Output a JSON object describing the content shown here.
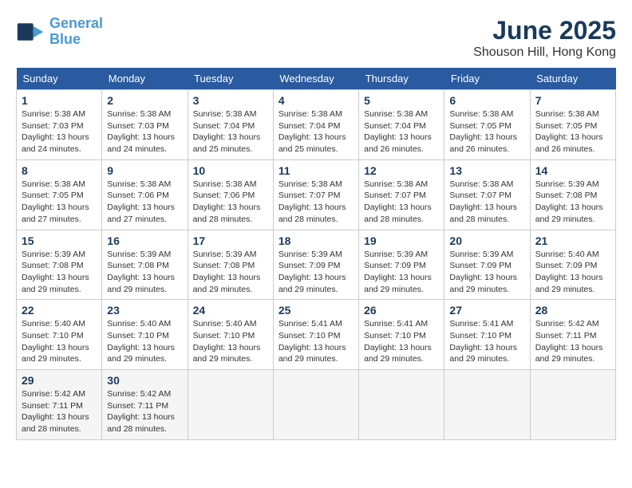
{
  "header": {
    "logo_line1": "General",
    "logo_line2": "Blue",
    "title": "June 2025",
    "subtitle": "Shouson Hill, Hong Kong"
  },
  "calendar": {
    "days_of_week": [
      "Sunday",
      "Monday",
      "Tuesday",
      "Wednesday",
      "Thursday",
      "Friday",
      "Saturday"
    ],
    "weeks": [
      [
        null,
        {
          "day": "2",
          "sunrise": "5:38 AM",
          "sunset": "7:03 PM",
          "daylight": "13 hours and 24 minutes."
        },
        {
          "day": "3",
          "sunrise": "5:38 AM",
          "sunset": "7:04 PM",
          "daylight": "13 hours and 25 minutes."
        },
        {
          "day": "4",
          "sunrise": "5:38 AM",
          "sunset": "7:04 PM",
          "daylight": "13 hours and 25 minutes."
        },
        {
          "day": "5",
          "sunrise": "5:38 AM",
          "sunset": "7:04 PM",
          "daylight": "13 hours and 26 minutes."
        },
        {
          "day": "6",
          "sunrise": "5:38 AM",
          "sunset": "7:05 PM",
          "daylight": "13 hours and 26 minutes."
        },
        {
          "day": "7",
          "sunrise": "5:38 AM",
          "sunset": "7:05 PM",
          "daylight": "13 hours and 26 minutes."
        }
      ],
      [
        {
          "day": "1",
          "sunrise": "5:38 AM",
          "sunset": "7:03 PM",
          "daylight": "13 hours and 24 minutes."
        },
        null,
        null,
        null,
        null,
        null,
        null
      ],
      [
        {
          "day": "8",
          "sunrise": "5:38 AM",
          "sunset": "7:05 PM",
          "daylight": "13 hours and 27 minutes."
        },
        {
          "day": "9",
          "sunrise": "5:38 AM",
          "sunset": "7:06 PM",
          "daylight": "13 hours and 27 minutes."
        },
        {
          "day": "10",
          "sunrise": "5:38 AM",
          "sunset": "7:06 PM",
          "daylight": "13 hours and 28 minutes."
        },
        {
          "day": "11",
          "sunrise": "5:38 AM",
          "sunset": "7:07 PM",
          "daylight": "13 hours and 28 minutes."
        },
        {
          "day": "12",
          "sunrise": "5:38 AM",
          "sunset": "7:07 PM",
          "daylight": "13 hours and 28 minutes."
        },
        {
          "day": "13",
          "sunrise": "5:38 AM",
          "sunset": "7:07 PM",
          "daylight": "13 hours and 28 minutes."
        },
        {
          "day": "14",
          "sunrise": "5:39 AM",
          "sunset": "7:08 PM",
          "daylight": "13 hours and 29 minutes."
        }
      ],
      [
        {
          "day": "15",
          "sunrise": "5:39 AM",
          "sunset": "7:08 PM",
          "daylight": "13 hours and 29 minutes."
        },
        {
          "day": "16",
          "sunrise": "5:39 AM",
          "sunset": "7:08 PM",
          "daylight": "13 hours and 29 minutes."
        },
        {
          "day": "17",
          "sunrise": "5:39 AM",
          "sunset": "7:08 PM",
          "daylight": "13 hours and 29 minutes."
        },
        {
          "day": "18",
          "sunrise": "5:39 AM",
          "sunset": "7:09 PM",
          "daylight": "13 hours and 29 minutes."
        },
        {
          "day": "19",
          "sunrise": "5:39 AM",
          "sunset": "7:09 PM",
          "daylight": "13 hours and 29 minutes."
        },
        {
          "day": "20",
          "sunrise": "5:39 AM",
          "sunset": "7:09 PM",
          "daylight": "13 hours and 29 minutes."
        },
        {
          "day": "21",
          "sunrise": "5:40 AM",
          "sunset": "7:09 PM",
          "daylight": "13 hours and 29 minutes."
        }
      ],
      [
        {
          "day": "22",
          "sunrise": "5:40 AM",
          "sunset": "7:10 PM",
          "daylight": "13 hours and 29 minutes."
        },
        {
          "day": "23",
          "sunrise": "5:40 AM",
          "sunset": "7:10 PM",
          "daylight": "13 hours and 29 minutes."
        },
        {
          "day": "24",
          "sunrise": "5:40 AM",
          "sunset": "7:10 PM",
          "daylight": "13 hours and 29 minutes."
        },
        {
          "day": "25",
          "sunrise": "5:41 AM",
          "sunset": "7:10 PM",
          "daylight": "13 hours and 29 minutes."
        },
        {
          "day": "26",
          "sunrise": "5:41 AM",
          "sunset": "7:10 PM",
          "daylight": "13 hours and 29 minutes."
        },
        {
          "day": "27",
          "sunrise": "5:41 AM",
          "sunset": "7:10 PM",
          "daylight": "13 hours and 29 minutes."
        },
        {
          "day": "28",
          "sunrise": "5:42 AM",
          "sunset": "7:11 PM",
          "daylight": "13 hours and 29 minutes."
        }
      ],
      [
        {
          "day": "29",
          "sunrise": "5:42 AM",
          "sunset": "7:11 PM",
          "daylight": "13 hours and 28 minutes."
        },
        {
          "day": "30",
          "sunrise": "5:42 AM",
          "sunset": "7:11 PM",
          "daylight": "13 hours and 28 minutes."
        },
        null,
        null,
        null,
        null,
        null
      ]
    ],
    "labels": {
      "sunrise": "Sunrise:",
      "sunset": "Sunset:",
      "daylight": "Daylight:"
    }
  }
}
